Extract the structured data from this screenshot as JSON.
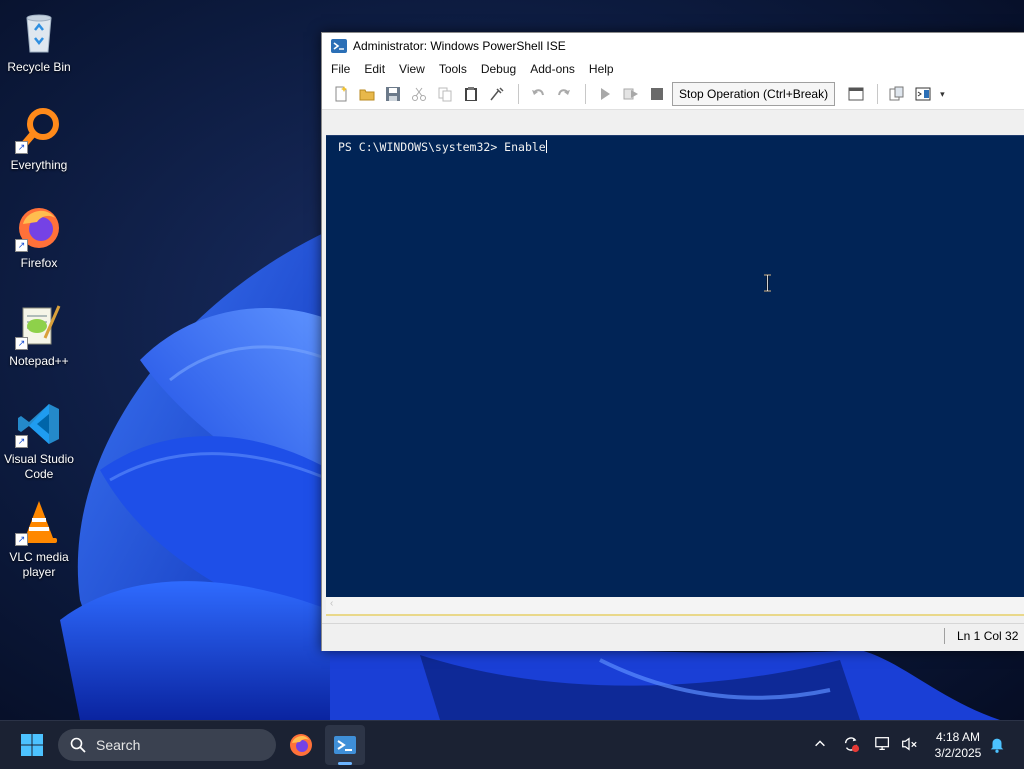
{
  "desktop": {
    "icons": [
      {
        "label": "Recycle Bin",
        "icon": "recycle-bin-icon"
      },
      {
        "label": "Everything",
        "icon": "everything-search-icon"
      },
      {
        "label": "Firefox",
        "icon": "firefox-icon"
      },
      {
        "label": "Notepad++",
        "icon": "notepad-plus-plus-icon"
      },
      {
        "label": "Visual Studio Code",
        "icon": "vscode-icon"
      },
      {
        "label": "VLC media player",
        "icon": "vlc-icon"
      }
    ]
  },
  "window": {
    "title": "Administrator: Windows PowerShell ISE",
    "menu": [
      "File",
      "Edit",
      "View",
      "Tools",
      "Debug",
      "Add-ons",
      "Help"
    ],
    "toolbar": {
      "stop_label": "Stop Operation (Ctrl+Break)"
    },
    "console": {
      "prompt": "PS C:\\WINDOWS\\system32> ",
      "input": "Enable"
    },
    "status": {
      "position": "Ln 1  Col 32"
    }
  },
  "taskbar": {
    "search_label": "Search",
    "time": "4:18 AM",
    "date": "3/2/2025"
  },
  "colors": {
    "console_bg": "#012456",
    "taskbar_bg": "#1b2233",
    "accent": "#0078d4"
  }
}
